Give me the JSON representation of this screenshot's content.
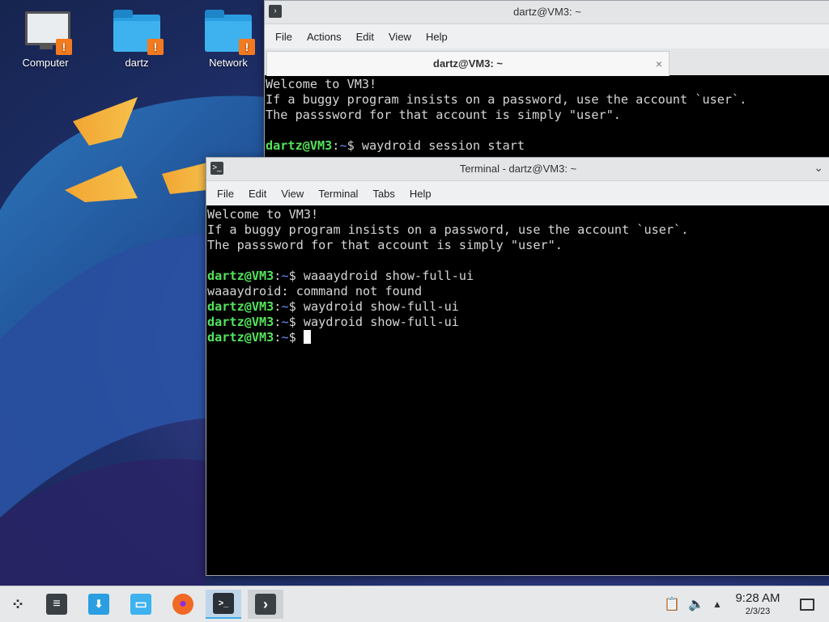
{
  "desktop": {
    "icons": [
      {
        "label": "Computer",
        "icon": "computer-icon"
      },
      {
        "label": "dartz",
        "icon": "home-folder-icon"
      },
      {
        "label": "Network",
        "icon": "network-folder-icon"
      }
    ],
    "badge_glyph": "!",
    "accent": "#3daee9"
  },
  "back_window": {
    "title": "dartz@VM3: ~",
    "menu": [
      "File",
      "Actions",
      "Edit",
      "View",
      "Help"
    ],
    "tab_label": "dartz@VM3: ~",
    "tab_close": "×",
    "lines": [
      {
        "type": "text",
        "text": "Welcome to VM3!"
      },
      {
        "type": "text",
        "text": "If a buggy program insists on a password, use the account `user`."
      },
      {
        "type": "text",
        "text": "The passsword for that account is simply \"user\"."
      },
      {
        "type": "text",
        "text": ""
      },
      {
        "type": "prompt",
        "user": "dartz@VM3",
        "sep": ":",
        "path": "~",
        "symbol": "$ ",
        "command": "waydroid session start"
      }
    ]
  },
  "front_window": {
    "title": "Terminal - dartz@VM3: ~",
    "menu": [
      "File",
      "Edit",
      "View",
      "Terminal",
      "Tabs",
      "Help"
    ],
    "lines": [
      {
        "type": "text",
        "text": "Welcome to VM3!"
      },
      {
        "type": "text",
        "text": "If a buggy program insists on a password, use the account `user`."
      },
      {
        "type": "text",
        "text": "The passsword for that account is simply \"user\"."
      },
      {
        "type": "text",
        "text": ""
      },
      {
        "type": "prompt",
        "user": "dartz@VM3",
        "sep": ":",
        "path": "~",
        "symbol": "$ ",
        "command": "waaaydroid show-full-ui"
      },
      {
        "type": "text",
        "text": "waaaydroid: command not found"
      },
      {
        "type": "prompt",
        "user": "dartz@VM3",
        "sep": ":",
        "path": "~",
        "symbol": "$ ",
        "command": "waydroid show-full-ui"
      },
      {
        "type": "prompt",
        "user": "dartz@VM3",
        "sep": ":",
        "path": "~",
        "symbol": "$ ",
        "command": "waydroid show-full-ui"
      },
      {
        "type": "prompt",
        "user": "dartz@VM3",
        "sep": ":",
        "path": "~",
        "symbol": "$ ",
        "command": "",
        "cursor": true
      }
    ]
  },
  "taskbar": {
    "launchers": [
      {
        "name": "application-launcher-icon",
        "glyph": "⁘"
      },
      {
        "name": "settings-icon",
        "glyph": "≡"
      },
      {
        "name": "discover-store-icon",
        "glyph": "⬇"
      },
      {
        "name": "file-manager-icon",
        "glyph": "▭"
      },
      {
        "name": "firefox-icon",
        "glyph": "●"
      },
      {
        "name": "xfce-terminal-icon",
        "glyph": ">_"
      },
      {
        "name": "konsole-icon",
        "glyph": "›"
      }
    ],
    "tray": {
      "clipboard_icon": "clipboard-icon",
      "volume_icon": "volume-icon",
      "expand_icon": "tray-expand-icon"
    },
    "clock": {
      "time": "9:28 AM",
      "date": "2/3/23"
    }
  }
}
